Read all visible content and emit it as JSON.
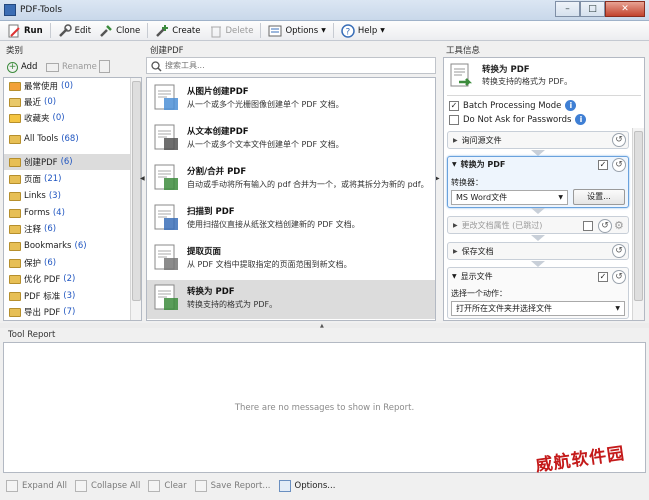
{
  "window": {
    "title": "PDF-Tools",
    "min": "–",
    "max": "□",
    "close": "✕"
  },
  "toolbar": {
    "run": "Run",
    "edit": "Edit",
    "clone": "Clone",
    "create": "Create",
    "delete": "Delete",
    "options": "Options",
    "help": "Help"
  },
  "categories": {
    "header": "类别",
    "add": "Add",
    "rename": "Rename",
    "items": [
      {
        "label": "最常使用",
        "count": "(0)"
      },
      {
        "label": "最近",
        "count": "(0)"
      },
      {
        "label": "收藏夹",
        "count": "(0)"
      },
      {
        "label": "All Tools",
        "count": "(68)"
      },
      {
        "label": "创建PDF",
        "count": "(6)"
      },
      {
        "label": "页面",
        "count": "(21)"
      },
      {
        "label": "Links",
        "count": "(3)"
      },
      {
        "label": "Forms",
        "count": "(4)"
      },
      {
        "label": "注释",
        "count": "(6)"
      },
      {
        "label": "Bookmarks",
        "count": "(6)"
      },
      {
        "label": "保护",
        "count": "(6)"
      },
      {
        "label": "优化 PDF",
        "count": "(2)"
      },
      {
        "label": "PDF 标准",
        "count": "(3)"
      },
      {
        "label": "导出 PDF",
        "count": "(7)"
      }
    ]
  },
  "tools": {
    "header": "创建PDF",
    "search_placeholder": "搜索工具...",
    "items": [
      {
        "name": "从图片创建PDF",
        "desc": "从一个或多个光栅图像创建单个 PDF 文档。"
      },
      {
        "name": "从文本创建PDF",
        "desc": "从一个或多个文本文件创建单个 PDF 文档。"
      },
      {
        "name": "分割/合并 PDF",
        "desc": "自动或手动将所有输入的 pdf 合并为一个，或将其拆分为新的 pdf。"
      },
      {
        "name": "扫描到 PDF",
        "desc": "使用扫描仪直接从纸张文档创建新的 PDF 文档。"
      },
      {
        "name": "提取页面",
        "desc": "从 PDF 文档中提取指定的页面范围到新文档。"
      },
      {
        "name": "转换为 PDF",
        "desc": "转换支持的格式为 PDF。"
      }
    ]
  },
  "info": {
    "header": "工具信息",
    "title": "转换为 PDF",
    "subtitle": "转换支持的格式为 PDF。",
    "batch": "Batch Processing Mode",
    "noask": "Do Not Ask for Passwords",
    "sec_source": "询问源文件",
    "sec_convert": "转换为 PDF",
    "converter_label": "转换器：",
    "converter_value": "MS Word文件",
    "settings": "设置...",
    "sec_props": "更改文档属性 (已跳过)",
    "sec_save": "保存文档",
    "sec_show": "显示文件",
    "action_label": "选择一个动作：",
    "action_value": "打开所在文件夹并选择文件"
  },
  "report": {
    "header": "Tool Report",
    "empty": "There are no messages to show in Report."
  },
  "bottom": {
    "expand": "Expand All",
    "collapse": "Collapse All",
    "clear": "Clear",
    "save": "Save Report...",
    "options": "Options..."
  },
  "watermark": "威航软件园",
  "colors": {
    "accent": "#3f7fd4",
    "selected": "#dcdcdc",
    "count": "#1f55c0",
    "folder": "#e7bf55"
  }
}
